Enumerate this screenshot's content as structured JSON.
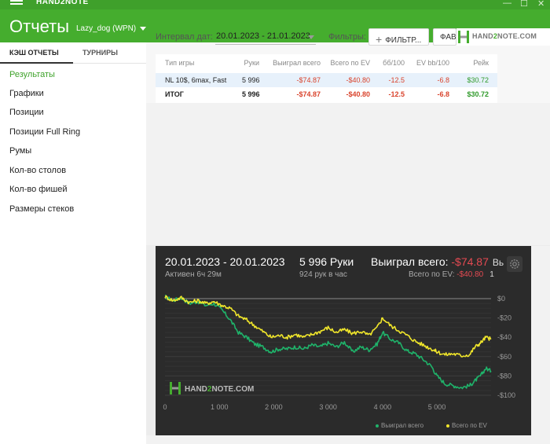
{
  "app": {
    "brand": "HAND2NOTE",
    "win_min": "—",
    "win_max": "☐",
    "win_close": "✕"
  },
  "header": {
    "title": "Отчеты",
    "user": "Lazy_dog (WPN)"
  },
  "sidebar": {
    "tabs": [
      "КЭШ ОТЧЕТЫ",
      "ТУРНИРЫ"
    ],
    "items": [
      {
        "label": "Результаты",
        "active": true
      },
      {
        "label": "Графики"
      },
      {
        "label": "Позиции"
      },
      {
        "label": "Позиции Full Ring"
      },
      {
        "label": "Румы"
      },
      {
        "label": "Кол-во столов"
      },
      {
        "label": "Кол-во фишей"
      },
      {
        "label": "Размеры стеков"
      }
    ]
  },
  "filters": {
    "interval_label": "Интервал дат:",
    "interval_value": "20.01.2023 - 21.01.2023",
    "filters_label": "Фильтры:",
    "filter_button": "ФИЛЬТР...",
    "fav_button": "ФАВ",
    "logo_pre": "HAND",
    "logo_two": "2",
    "logo_post": "NOTE.COM"
  },
  "table": {
    "headers": [
      "Тип игры",
      "Руки",
      "Выиграл всего",
      "Всего по EV",
      "бб/100",
      "EV bb/100",
      "Рейк"
    ],
    "rows": [
      [
        "NL 10$, 6max, Fast",
        "5 996",
        "-$74.87",
        "-$40.80",
        "-12.5",
        "-6.8",
        "$30.72"
      ],
      [
        "ИТОГ",
        "5 996",
        "-$74.87",
        "-$40.80",
        "-12.5",
        "-6.8",
        "$30.72"
      ]
    ]
  },
  "summary": {
    "dates": "20.01.2023 - 20.01.2023",
    "active": "Активен 6ч 29м",
    "hands": "5 996 Руки",
    "rate": "924 рук в час",
    "won_label": "Выиграл всего:",
    "won_value": "-$74.87",
    "won_cut": "Вь",
    "ev_label": "Всего по EV:",
    "ev_value": "-$40.80",
    "ev_cut": "1"
  },
  "chart_logo": {
    "pre": "HAND",
    "two": "2",
    "post": "NOTE.COM"
  },
  "chart_data": {
    "type": "line",
    "x_ticks": [
      "0",
      "1 000",
      "2 000",
      "3 000",
      "4 000",
      "5 000"
    ],
    "y_ticks": [
      "$0",
      "-$20",
      "-$40",
      "-$60",
      "-$80",
      "-$100"
    ],
    "xlim": [
      0,
      5996
    ],
    "ylim": [
      -100,
      0
    ],
    "grid": true,
    "legend": "bottom-right",
    "series": [
      {
        "name": "Выиграл всего",
        "color": "#1fb36a",
        "points": [
          [
            0,
            2
          ],
          [
            150,
            -2
          ],
          [
            300,
            1
          ],
          [
            450,
            -5
          ],
          [
            600,
            -3
          ],
          [
            750,
            -7
          ],
          [
            900,
            -5
          ],
          [
            1050,
            -12
          ],
          [
            1200,
            -22
          ],
          [
            1350,
            -35
          ],
          [
            1500,
            -40
          ],
          [
            1650,
            -47
          ],
          [
            1800,
            -50
          ],
          [
            1950,
            -55
          ],
          [
            2100,
            -52
          ],
          [
            2250,
            -52
          ],
          [
            2400,
            -50
          ],
          [
            2550,
            -52
          ],
          [
            2700,
            -48
          ],
          [
            2850,
            -50
          ],
          [
            3000,
            -46
          ],
          [
            3150,
            -50
          ],
          [
            3300,
            -45
          ],
          [
            3450,
            -55
          ],
          [
            3600,
            -50
          ],
          [
            3750,
            -53
          ],
          [
            3900,
            -47
          ],
          [
            4000,
            -35
          ],
          [
            4150,
            -42
          ],
          [
            4300,
            -46
          ],
          [
            4450,
            -54
          ],
          [
            4600,
            -57
          ],
          [
            4750,
            -63
          ],
          [
            4900,
            -70
          ],
          [
            5000,
            -80
          ],
          [
            5150,
            -88
          ],
          [
            5300,
            -90
          ],
          [
            5450,
            -92
          ],
          [
            5600,
            -90
          ],
          [
            5700,
            -85
          ],
          [
            5800,
            -80
          ],
          [
            5900,
            -72
          ],
          [
            5996,
            -75
          ]
        ]
      },
      {
        "name": "Всего по EV",
        "color": "#f0e62b",
        "points": [
          [
            0,
            2
          ],
          [
            150,
            -2
          ],
          [
            300,
            1
          ],
          [
            450,
            -4
          ],
          [
            600,
            -2
          ],
          [
            750,
            -5
          ],
          [
            900,
            -3
          ],
          [
            1050,
            -7
          ],
          [
            1200,
            -10
          ],
          [
            1350,
            -18
          ],
          [
            1500,
            -22
          ],
          [
            1650,
            -28
          ],
          [
            1800,
            -34
          ],
          [
            1950,
            -40
          ],
          [
            2100,
            -38
          ],
          [
            2250,
            -40
          ],
          [
            2400,
            -37
          ],
          [
            2550,
            -40
          ],
          [
            2700,
            -37
          ],
          [
            2850,
            -34
          ],
          [
            3000,
            -30
          ],
          [
            3150,
            -35
          ],
          [
            3300,
            -32
          ],
          [
            3450,
            -36
          ],
          [
            3600,
            -34
          ],
          [
            3750,
            -38
          ],
          [
            3900,
            -30
          ],
          [
            4000,
            -20
          ],
          [
            4150,
            -28
          ],
          [
            4300,
            -33
          ],
          [
            4450,
            -38
          ],
          [
            4600,
            -44
          ],
          [
            4750,
            -48
          ],
          [
            4900,
            -52
          ],
          [
            5000,
            -55
          ],
          [
            5150,
            -58
          ],
          [
            5300,
            -57
          ],
          [
            5450,
            -59
          ],
          [
            5600,
            -58
          ],
          [
            5700,
            -50
          ],
          [
            5800,
            -46
          ],
          [
            5900,
            -40
          ],
          [
            5996,
            -42
          ]
        ]
      }
    ]
  }
}
